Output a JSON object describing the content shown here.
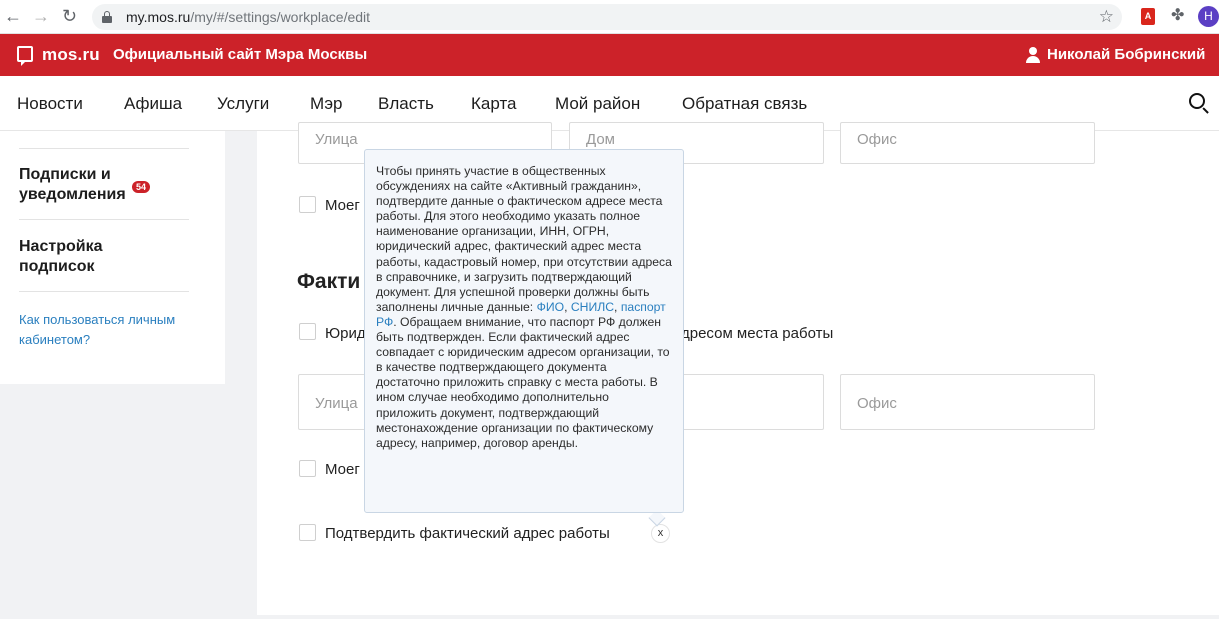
{
  "browser": {
    "back": "←",
    "forward": "→",
    "reload": "↻",
    "url_host": "my.mos.ru",
    "url_path": "/my/#/settings/workplace/edit",
    "star": "☆",
    "pdf_ext": "⅄",
    "puzzle": "✤",
    "profile_initial": "Н"
  },
  "header": {
    "logo": "mos.ru",
    "site_title": "Официальный сайт Мэра Москвы",
    "user_name": "Николай Бобринский",
    "accent_color": "#cc2229"
  },
  "nav": {
    "items": [
      "Новости",
      "Афиша",
      "Услуги",
      "Мэр",
      "Власть",
      "Карта",
      "Мой район",
      "Обратная связь"
    ]
  },
  "sidebar": {
    "subscriptions": "Подписки и уведомления",
    "subscriptions_line1": "Подписки и",
    "subscriptions_line2": "уведомления",
    "badge": "54",
    "settings_line1": "Настройка",
    "settings_line2": "подписок",
    "help_link": "Как пользоваться личным кабинетом?"
  },
  "form": {
    "street_placeholder": "Улица",
    "house_placeholder": "Дом",
    "office_placeholder": "Офис",
    "my_address_label_partial": "Моег",
    "section_title_partial": "Факти",
    "legal_checkbox_partial_start": "Юрид",
    "legal_checkbox_partial_end": "дресом места работы",
    "confirm_label": "Подтвердить фактический адрес работы",
    "close": "x"
  },
  "tooltip": {
    "text_before": "Чтобы принять участие в общественных обсуждениях на сайте «Активный гражданин», подтвердите данные о фактическом адресе места работы. Для этого необходимо указать полное наименование организации, ИНН, ОГРН, юридический адрес, фактический адрес места работы, кадастровый номер, при отсутствии адреса в справочнике, и загрузить подтверждающий документ. Для успешной проверки должны быть заполнены личные данные: ",
    "link_fio": "ФИО",
    "comma1": ", ",
    "link_snils": "СНИЛС",
    "comma2": ", ",
    "link_passport": "паспорт РФ",
    "text_after": ". Обращаем внимание, что паспорт РФ должен быть подтвержден. Если фактический адрес совпадает с юридическим адресом организации, то в качестве подтверждающего документа достаточно приложить справку с места работы. В ином случае необходимо дополнительно приложить документ, подтверждающий местонахождение организации по фактическому адресу, например, договор аренды."
  }
}
